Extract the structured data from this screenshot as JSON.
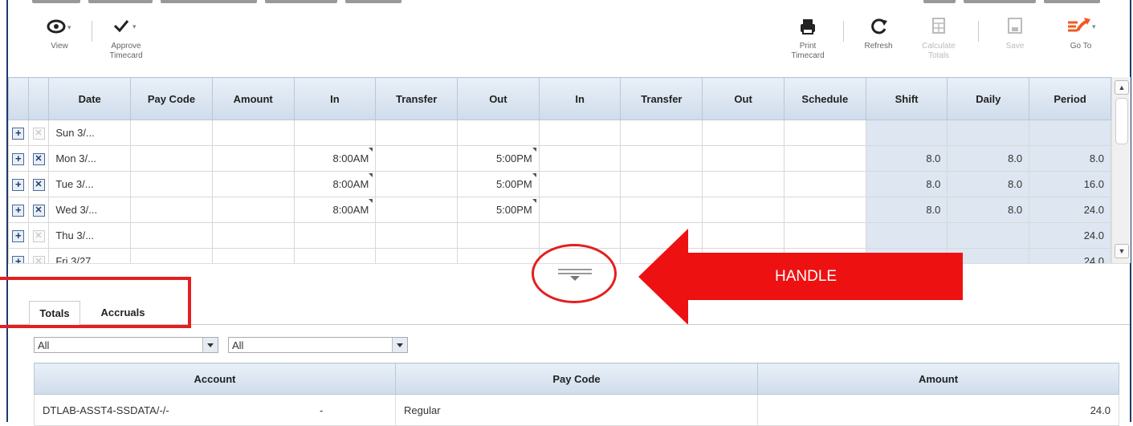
{
  "toolbar": {
    "view": {
      "label": "View",
      "icon": "eye-icon"
    },
    "approve": {
      "label": "Approve Timecard",
      "icon": "checkmark-icon"
    },
    "print": {
      "label": "Print Timecard",
      "icon": "printer-icon"
    },
    "refresh": {
      "label": "Refresh",
      "icon": "refresh-icon"
    },
    "calculate": {
      "label": "Calculate Totals",
      "icon": "calculator-icon"
    },
    "save": {
      "label": "Save",
      "icon": "save-icon"
    },
    "goto": {
      "label": "Go To",
      "icon": "goto-arrow-icon"
    }
  },
  "grid": {
    "columns": [
      "Date",
      "Pay Code",
      "Amount",
      "In",
      "Transfer",
      "Out",
      "In",
      "Transfer",
      "Out",
      "Schedule",
      "Shift",
      "Daily",
      "Period"
    ],
    "rows": [
      {
        "date": "Sun 3/...",
        "in": "",
        "out": "",
        "shift": "",
        "daily": "",
        "period": "",
        "deletable": false
      },
      {
        "date": "Mon 3/...",
        "in": "8:00AM",
        "out": "5:00PM",
        "shift": "8.0",
        "daily": "8.0",
        "period": "8.0",
        "deletable": true
      },
      {
        "date": "Tue 3/...",
        "in": "8:00AM",
        "out": "5:00PM",
        "shift": "8.0",
        "daily": "8.0",
        "period": "16.0",
        "deletable": true
      },
      {
        "date": "Wed 3/...",
        "in": "8:00AM",
        "out": "5:00PM",
        "shift": "8.0",
        "daily": "8.0",
        "period": "24.0",
        "deletable": true
      },
      {
        "date": "Thu 3/...",
        "in": "",
        "out": "",
        "shift": "",
        "daily": "",
        "period": "24.0",
        "deletable": false
      },
      {
        "date": "Fri 3/27",
        "in": "",
        "out": "",
        "shift": "",
        "daily": "",
        "period": "24.0",
        "deletable": false
      }
    ]
  },
  "annotation": {
    "handle_label": "HANDLE",
    "color": "#ee1111"
  },
  "tabs": {
    "totals": "Totals",
    "accruals": "Accruals"
  },
  "filters": {
    "first": "All",
    "second": "All"
  },
  "totals": {
    "columns": [
      "Account",
      "Pay Code",
      "Amount"
    ],
    "rows": [
      {
        "account": "DTLAB-ASST4-SSDATA/-/-",
        "sep": "-",
        "paycode": "Regular",
        "amount": "24.0"
      }
    ]
  },
  "colors": {
    "header": "#cfdceb",
    "calc_cell": "#dde6f1",
    "goto_orange": "#f05a22",
    "frame": "#1f3a6a"
  }
}
